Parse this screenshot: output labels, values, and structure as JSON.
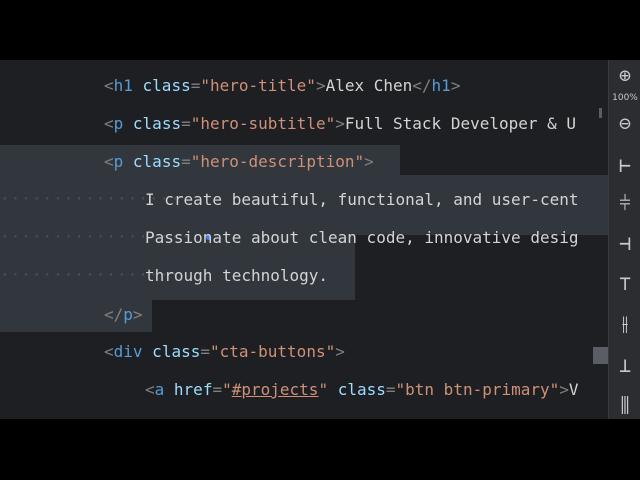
{
  "editor": {
    "lines": [
      [
        {
          "t": "<",
          "c": "punc"
        },
        {
          "t": "h1",
          "c": "tag"
        },
        {
          "t": " class",
          "c": "attr"
        },
        {
          "t": "=",
          "c": "punc"
        },
        {
          "t": "\"hero-title\"",
          "c": "str"
        },
        {
          "t": ">",
          "c": "punc"
        },
        {
          "t": "Alex Chen",
          "c": "text"
        },
        {
          "t": "</",
          "c": "punc"
        },
        {
          "t": "h1",
          "c": "tag"
        },
        {
          "t": ">",
          "c": "punc"
        }
      ],
      [
        {
          "t": "<",
          "c": "punc"
        },
        {
          "t": "p",
          "c": "tag"
        },
        {
          "t": " class",
          "c": "attr"
        },
        {
          "t": "=",
          "c": "punc"
        },
        {
          "t": "\"hero-subtitle\"",
          "c": "str"
        },
        {
          "t": ">",
          "c": "punc"
        },
        {
          "t": "Full Stack Developer & U",
          "c": "text"
        }
      ],
      [
        {
          "t": "<",
          "c": "punc"
        },
        {
          "t": "p",
          "c": "tag"
        },
        {
          "t": " class",
          "c": "attr"
        },
        {
          "t": "=",
          "c": "punc"
        },
        {
          "t": "\"hero-description\"",
          "c": "str"
        },
        {
          "t": ">",
          "c": "punc"
        }
      ],
      [
        {
          "t": "I create beautiful, functional, and user-cent",
          "c": "text"
        }
      ],
      [
        {
          "t": "Passionate about clean code, innovative desig",
          "c": "text"
        }
      ],
      [
        {
          "t": "through technology.",
          "c": "text"
        }
      ],
      [
        {
          "t": "</",
          "c": "punc"
        },
        {
          "t": "p",
          "c": "tag"
        },
        {
          "t": ">",
          "c": "punc"
        }
      ],
      [
        {
          "t": "<",
          "c": "punc"
        },
        {
          "t": "div",
          "c": "tag"
        },
        {
          "t": " class",
          "c": "attr"
        },
        {
          "t": "=",
          "c": "punc"
        },
        {
          "t": "\"cta-buttons\"",
          "c": "str"
        },
        {
          "t": ">",
          "c": "punc"
        }
      ],
      [
        {
          "t": "<",
          "c": "punc"
        },
        {
          "t": "a",
          "c": "tag"
        },
        {
          "t": " href",
          "c": "attr"
        },
        {
          "t": "=",
          "c": "punc"
        },
        {
          "t": "\"",
          "c": "str"
        },
        {
          "t": "#projects",
          "c": "link"
        },
        {
          "t": "\"",
          "c": "str"
        },
        {
          "t": " class",
          "c": "attr"
        },
        {
          "t": "=",
          "c": "punc"
        },
        {
          "t": "\"btn btn-primary\"",
          "c": "str"
        },
        {
          "t": ">",
          "c": "punc"
        },
        {
          "t": "V",
          "c": "text"
        }
      ]
    ]
  },
  "toolbar": {
    "zoom_level": "100%",
    "buttons": [
      {
        "name": "zoom-in-icon",
        "glyph": "⊕"
      },
      {
        "name": "zoom-out-icon",
        "glyph": "⊖"
      },
      {
        "name": "align-left-icon",
        "glyph": "⊢"
      },
      {
        "name": "align-center-horizontal-icon",
        "glyph": "⫩"
      },
      {
        "name": "align-right-icon",
        "glyph": "⊣"
      },
      {
        "name": "align-top-icon",
        "glyph": "⊤"
      },
      {
        "name": "align-center-vertical-icon",
        "glyph": "⫲"
      },
      {
        "name": "align-bottom-icon",
        "glyph": "⊥"
      },
      {
        "name": "distribute-icon",
        "glyph": "⫼"
      }
    ]
  },
  "colors": {
    "background": "#1e1f22",
    "selection": "#32363d",
    "tag": "#569cd6",
    "attribute": "#9cdcfe",
    "string": "#ce9178",
    "text": "#d4d4d4",
    "punctuation": "#808080"
  }
}
